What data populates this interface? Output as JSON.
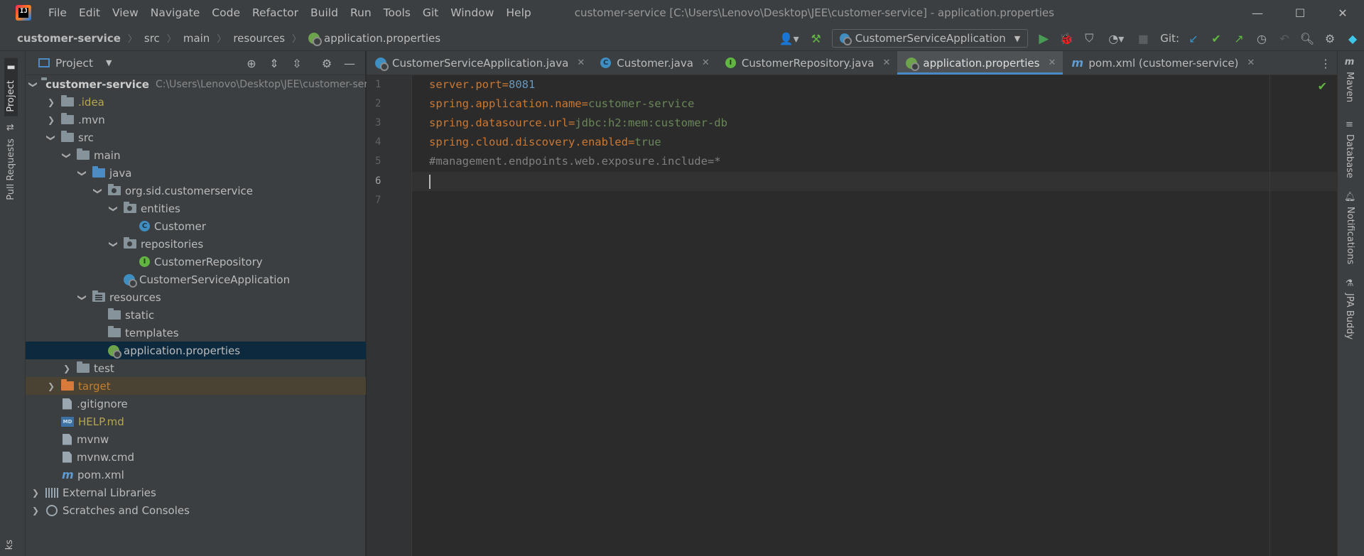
{
  "window": {
    "title": "customer-service [C:\\Users\\Lenovo\\Desktop\\JEE\\customer-service] - application.properties",
    "minimize": "—",
    "maximize": "☐",
    "close": "✕"
  },
  "menu": [
    "File",
    "Edit",
    "View",
    "Navigate",
    "Code",
    "Refactor",
    "Build",
    "Run",
    "Tools",
    "Git",
    "Window",
    "Help"
  ],
  "breadcrumbs": [
    "customer-service",
    "src",
    "main",
    "resources",
    "application.properties"
  ],
  "toolbar": {
    "run_config": "CustomerServiceApplication",
    "git_label": "Git:"
  },
  "project_panel": {
    "title": "Project"
  },
  "tree": {
    "root": "customer-service",
    "root_path": "C:\\Users\\Lenovo\\Desktop\\JEE\\customer-servi",
    "idea": ".idea",
    "mvn": ".mvn",
    "src": "src",
    "main": "main",
    "java": "java",
    "pkg": "org.sid.customerservice",
    "entities": "entities",
    "customer": "Customer",
    "repositories": "repositories",
    "customer_repository": "CustomerRepository",
    "app_class": "CustomerServiceApplication",
    "resources": "resources",
    "static": "static",
    "templates": "templates",
    "app_props": "application.properties",
    "test": "test",
    "target": "target",
    "gitignore": ".gitignore",
    "help": "HELP.md",
    "mvnw": "mvnw",
    "mvnw_cmd": "mvnw.cmd",
    "pom": "pom.xml",
    "external_libraries": "External Libraries",
    "scratches": "Scratches and Consoles"
  },
  "tabs": [
    {
      "label": "CustomerServiceApplication.java"
    },
    {
      "label": "Customer.java"
    },
    {
      "label": "CustomerRepository.java"
    },
    {
      "label": "application.properties"
    },
    {
      "label": "pom.xml (customer-service)"
    }
  ],
  "code": {
    "line_numbers": [
      "1",
      "2",
      "3",
      "4",
      "5",
      "6",
      "7"
    ],
    "l1_key": "server.port",
    "l1_val": "8081",
    "l2_key": "spring.application.name",
    "l2_val": "customer-service",
    "l3_key": "spring.datasource.url",
    "l3_val": "jdbc:h2:mem:customer-db",
    "l4_key": "spring.cloud.discovery.enabled",
    "l4_val": "true",
    "l5_comment": "#management.endpoints.web.exposure.include=*",
    "eq": "="
  },
  "left_strip": {
    "project": "Project",
    "pull_requests": "Pull Requests",
    "bottom": "ks"
  },
  "right_strip": {
    "maven": "Maven",
    "database": "Database",
    "notifications": "Notifications",
    "jpa_buddy": "JPA Buddy"
  }
}
